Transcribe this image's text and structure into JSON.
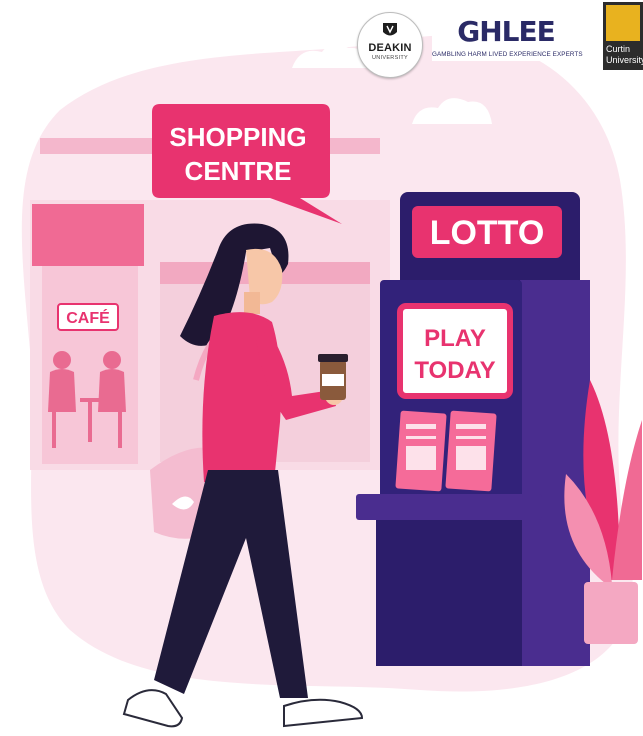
{
  "signs": {
    "shopping_line1": "SHOPPING",
    "shopping_line2": "CENTRE",
    "cafe": "CAFÉ",
    "lotto": "LOTTO",
    "play_line1": "PLAY",
    "play_line2": "TODAY"
  },
  "logos": {
    "deakin_name": "DEAKIN",
    "deakin_sub": "UNIVERSITY",
    "ghlee_word": "GHLEE",
    "ghlee_sub": "GAMBLING HARM LIVED EXPERIENCE EXPERTS",
    "curtin_line1": "Curtin",
    "curtin_line2": "University"
  },
  "colors": {
    "brand_pink": "#e8336f",
    "light_pink": "#f7d3e1",
    "navy": "#2c1d6b",
    "purple": "#4a2d8f",
    "curtin_gold": "#e8b21f"
  }
}
